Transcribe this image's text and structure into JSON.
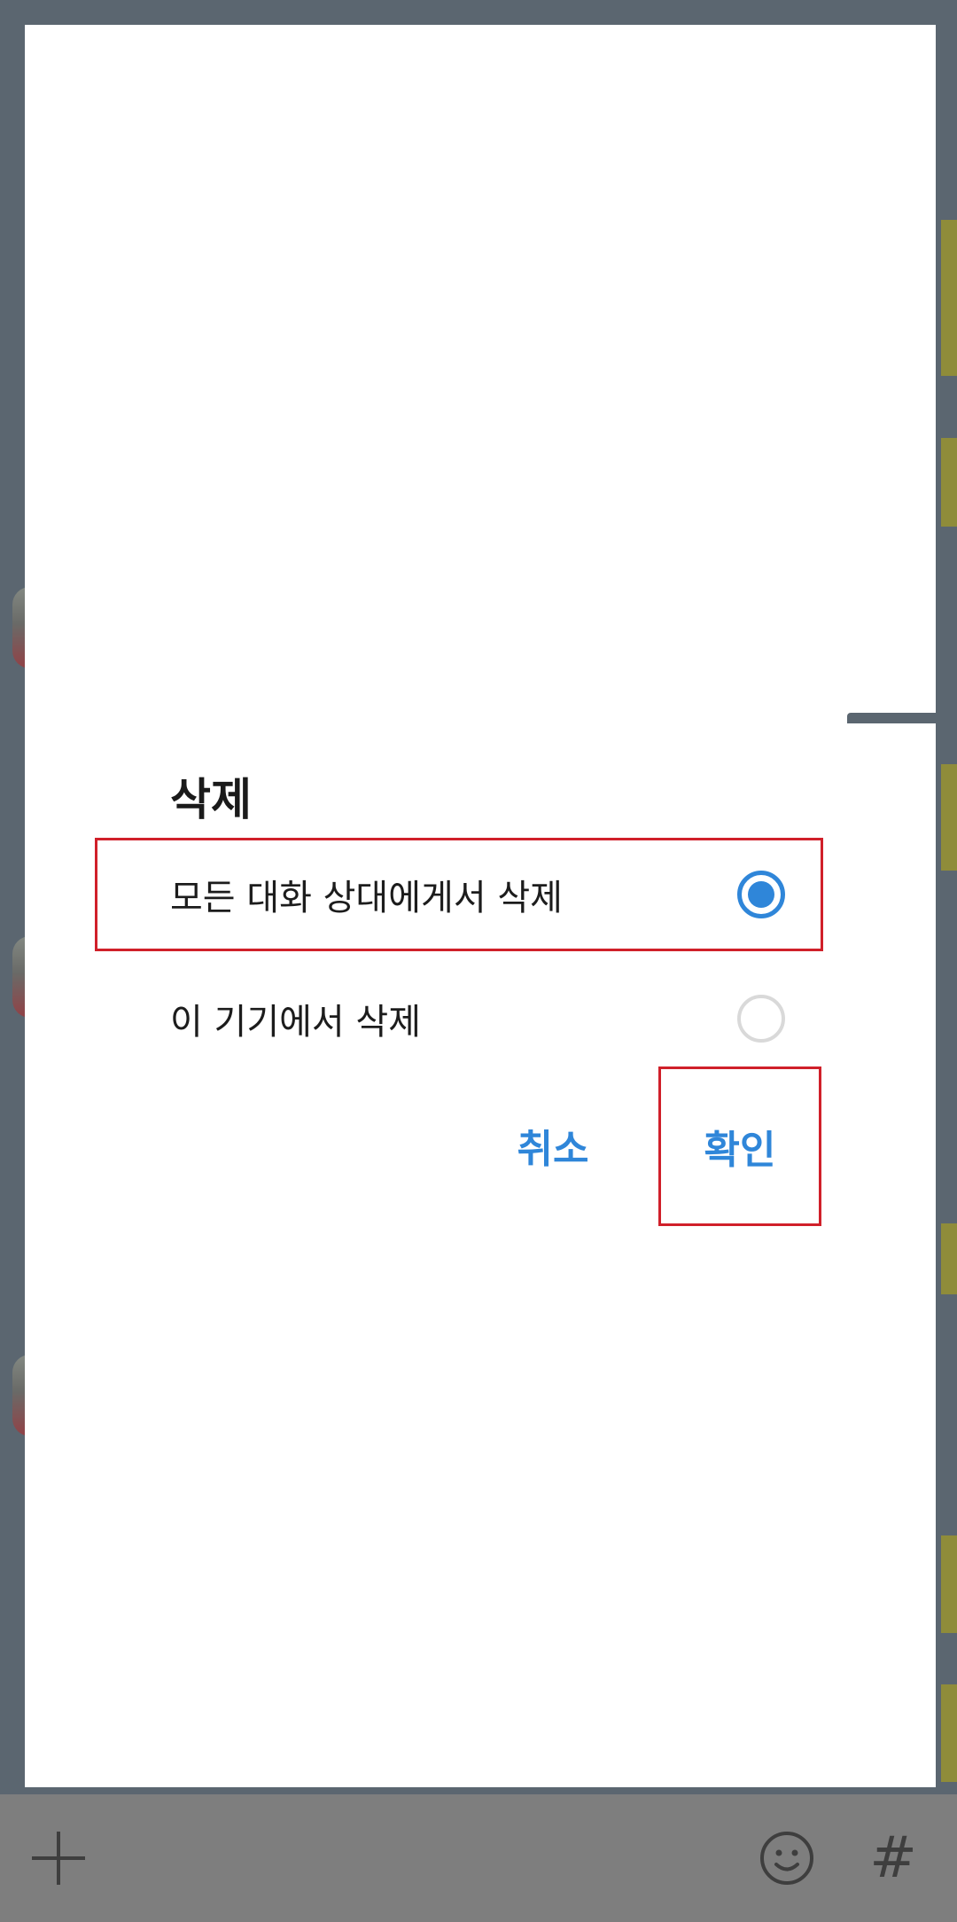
{
  "dialog": {
    "title": "삭제",
    "options": [
      {
        "label": "모든 대화 상대에게서 삭제",
        "selected": true
      },
      {
        "label": "이 기기에서 삭제",
        "selected": false
      }
    ],
    "cancel_label": "취소",
    "confirm_label": "확인"
  },
  "bottom_bar": {
    "left_icon": "plus-icon",
    "right_icons": [
      "emoji-icon",
      "hash-icon"
    ],
    "hash_glyph": "#"
  },
  "colors": {
    "accent": "#2f86d9",
    "highlight": "#d0202a",
    "overlay": "#5b6670"
  }
}
